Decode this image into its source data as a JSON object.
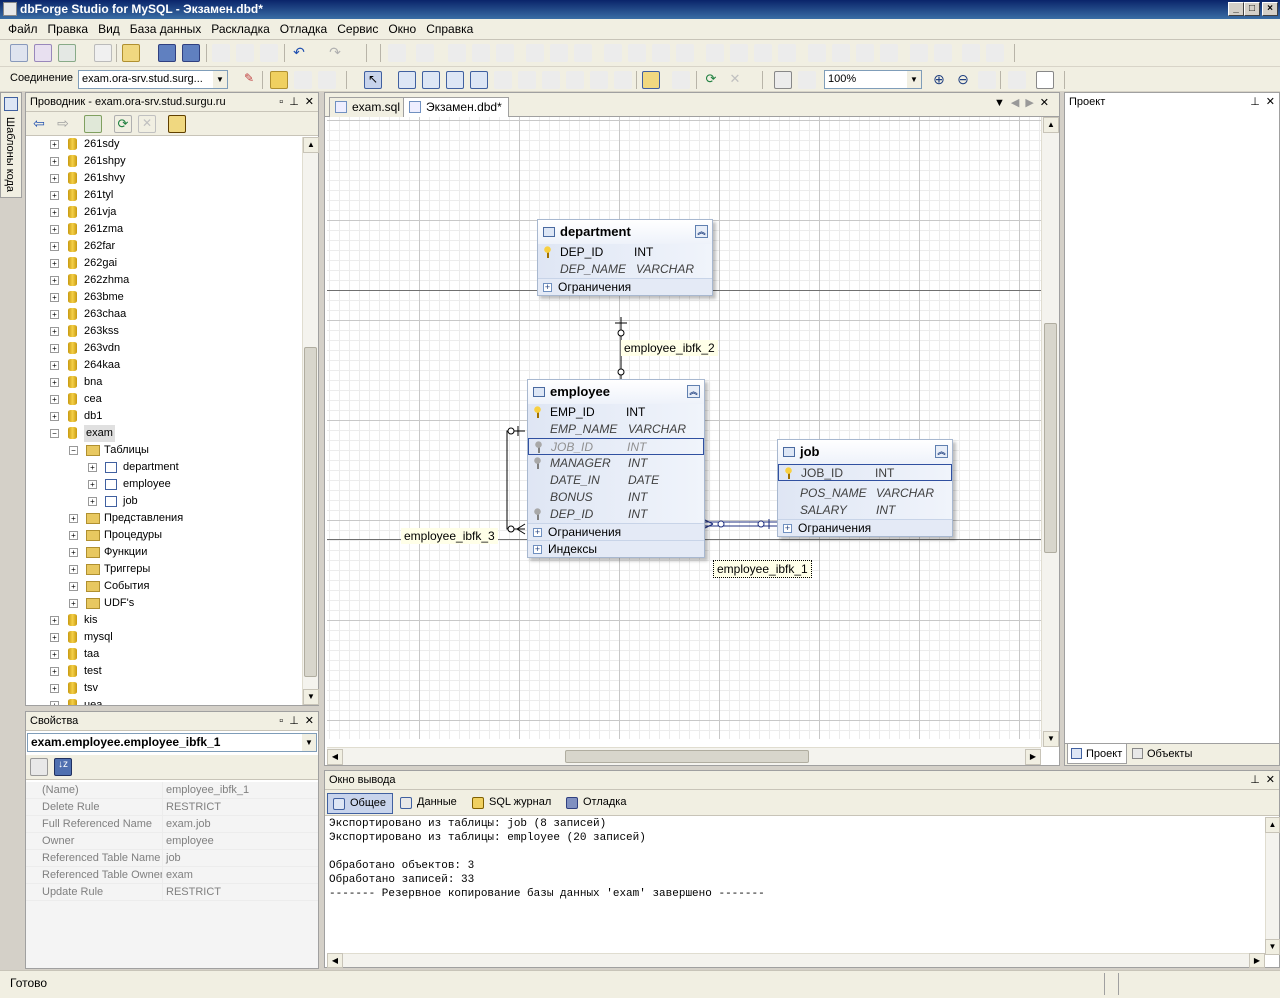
{
  "window": {
    "title": "dbForge Studio for MySQL - Экзамен.dbd*"
  },
  "menu": [
    "Файл",
    "Правка",
    "Вид",
    "База данных",
    "Раскладка",
    "Отладка",
    "Сервис",
    "Окно",
    "Справка"
  ],
  "connection": {
    "label": "Соединение",
    "value": "exam.ora-srv.stud.surg...",
    "zoom": "100%"
  },
  "left_strip": {
    "label": "Шаблоны кода"
  },
  "explorer": {
    "title": "Проводник - exam.ora-srv.stud.surgu.ru",
    "databases_top": [
      "261sdy",
      "261shpy",
      "261shvy",
      "261tyl",
      "261vja",
      "261zma",
      "262far",
      "262gai",
      "262zhma",
      "263bme",
      "263chaa",
      "263kss",
      "263vdn",
      "264kaa",
      "bna",
      "cea",
      "db1"
    ],
    "exam": "exam",
    "tables_folder": "Таблицы",
    "tables": [
      "department",
      "employee",
      "job"
    ],
    "folders": [
      "Представления",
      "Процедуры",
      "Функции",
      "Триггеры",
      "События",
      "UDF's"
    ],
    "databases_bottom": [
      "kis",
      "mysql",
      "taa",
      "test",
      "tsv",
      "uea"
    ]
  },
  "properties": {
    "title": "Свойства",
    "selected": "exam.employee.employee_ibfk_1",
    "rows": [
      {
        "k": "(Name)",
        "v": "employee_ibfk_1"
      },
      {
        "k": "Delete Rule",
        "v": "RESTRICT"
      },
      {
        "k": "Full Referenced Name",
        "v": "exam.job"
      },
      {
        "k": "Owner",
        "v": "employee"
      },
      {
        "k": "Referenced Table Name",
        "v": "job"
      },
      {
        "k": "Referenced Table Owner",
        "v": "exam"
      },
      {
        "k": "Update Rule",
        "v": "RESTRICT"
      }
    ]
  },
  "doc_tabs": [
    "exam.sql",
    "Экзамен.dbd*"
  ],
  "diagram": {
    "department": {
      "name": "department",
      "cols": [
        [
          "DEP_ID",
          "INT"
        ],
        [
          "DEP_NAME",
          "VARCHAR"
        ]
      ],
      "sections": [
        "Ограничения"
      ]
    },
    "employee": {
      "name": "employee",
      "cols": [
        [
          "EMP_ID",
          "INT"
        ],
        [
          "EMP_NAME",
          "VARCHAR"
        ],
        [
          "JOB_ID",
          "INT"
        ],
        [
          "MANAGER",
          "INT"
        ],
        [
          "DATE_IN",
          "DATE"
        ],
        [
          "BONUS",
          "INT"
        ],
        [
          "DEP_ID",
          "INT"
        ]
      ],
      "sections": [
        "Ограничения",
        "Индексы"
      ]
    },
    "job": {
      "name": "job",
      "cols": [
        [
          "JOB_ID",
          "INT"
        ],
        [
          "POS_NAME",
          "VARCHAR"
        ],
        [
          "SALARY",
          "INT"
        ]
      ],
      "sections": [
        "Ограничения"
      ]
    },
    "relations": [
      "employee_ibfk_2",
      "employee_ibfk_3",
      "employee_ibfk_1"
    ]
  },
  "project_panel": {
    "title": "Проект",
    "tabs": [
      "Проект",
      "Объекты"
    ]
  },
  "output": {
    "title": "Окно вывода",
    "tabs": [
      "Общее",
      "Данные",
      "SQL журнал",
      "Отладка"
    ],
    "lines": [
      "Экспортировано из таблицы: job (8 записей)",
      "Экспортировано из таблицы: employee (20 записей)",
      "",
      "Обработано объектов: 3",
      "Обработано записей: 33",
      "------- Резервное копирование базы данных 'exam' завершено -------"
    ]
  },
  "status": {
    "text": "Готово"
  }
}
